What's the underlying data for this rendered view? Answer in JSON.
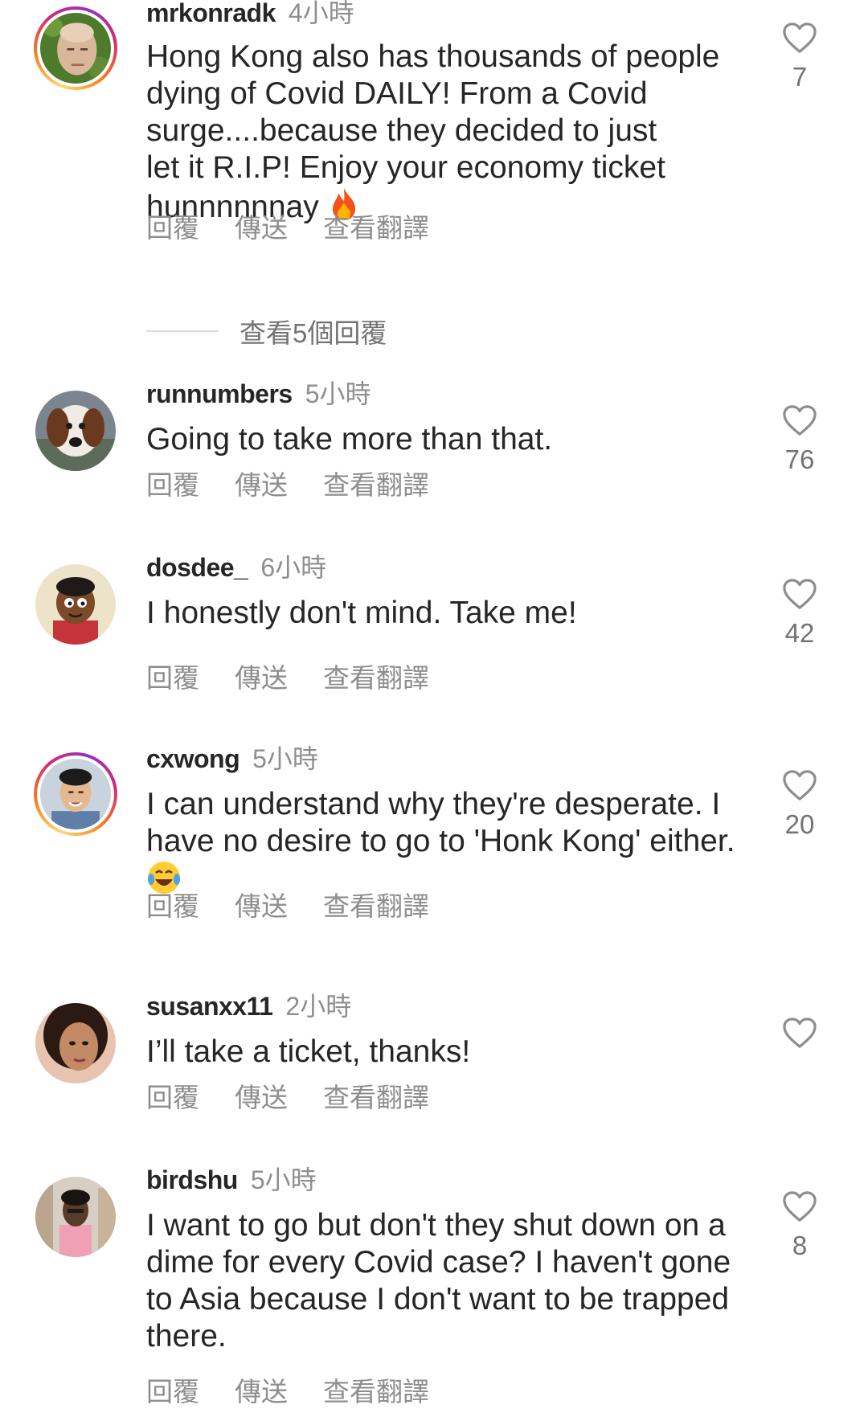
{
  "view_replies": "查看5個回覆",
  "actions": {
    "reply": "回覆",
    "send": "傳送",
    "translate": "查看翻譯"
  },
  "comments": [
    {
      "username": "mrkonradk",
      "time": "4小時",
      "lines": [
        "Hong Kong also has thousands of people",
        "dying of Covid DAILY! From a Covid",
        "surge....because they decided to just",
        "let it R.I.P! Enjoy your economy ticket",
        "hunnnnnnay"
      ],
      "emoji": "fire-emoji",
      "likes": "7"
    },
    {
      "username": "runnumbers",
      "time": "5小時",
      "lines": [
        "Going to take more than that."
      ],
      "likes": "76"
    },
    {
      "username": "dosdee_",
      "time": "6小時",
      "lines": [
        "I honestly don't mind. Take me!"
      ],
      "likes": "42"
    },
    {
      "username": "cxwong",
      "time": "5小時",
      "lines": [
        "I can understand why they're desperate. I",
        "have no desire to go to 'Honk Kong' either."
      ],
      "emoji": "laughing-tears-emoji",
      "likes": "20"
    },
    {
      "username": "susanxx11",
      "time": "2小時",
      "lines": [
        "I’ll take a ticket, thanks!"
      ],
      "likes": ""
    },
    {
      "username": "birdshu",
      "time": "5小時",
      "lines": [
        "I want to go but don't they shut down on a",
        "dime for every Covid case? I haven't gone",
        "to Asia because I don't want to be trapped",
        "there."
      ],
      "likes": "8"
    }
  ],
  "colors": {
    "text": "#262626",
    "secondary": "#8e8e8e",
    "story_ring": "#d62976"
  }
}
